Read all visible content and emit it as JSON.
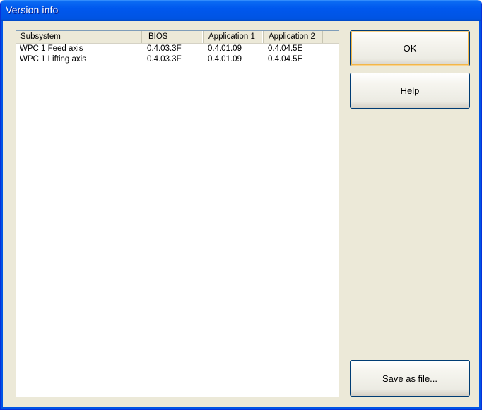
{
  "window": {
    "title": "Version info"
  },
  "list": {
    "columns": [
      "Subsystem",
      "BIOS",
      "Application 1",
      "Application 2"
    ],
    "rows": [
      [
        "WPC 1 Feed axis",
        "0.4.03.3F",
        "0.4.01.09",
        "0.4.04.5E"
      ],
      [
        "WPC 1 Lifting axis",
        "0.4.03.3F",
        "0.4.01.09",
        "0.4.04.5E"
      ]
    ]
  },
  "buttons": {
    "ok_label": "OK",
    "help_label": "Help",
    "save_label": "Save as file..."
  },
  "colors": {
    "titlebar": "#0054e3",
    "window_bg": "#ece9d8",
    "default_button_focus": "#f2b648"
  }
}
